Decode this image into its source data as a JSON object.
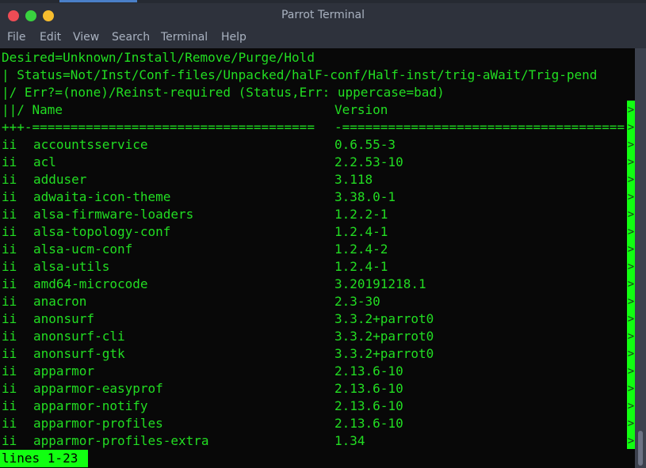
{
  "window": {
    "title": "Parrot Terminal",
    "controls": [
      "close",
      "maximize",
      "minimize"
    ]
  },
  "menu": [
    "File",
    "Edit",
    "View",
    "Search",
    "Terminal",
    "Help"
  ],
  "header_lines": [
    "Desired=Unknown/Install/Remove/Purge/Hold",
    "| Status=Not/Inst/Conf-files/Unpacked/halF-conf/Half-inst/trig-aWait/Trig-pend",
    "|/ Err?=(none)/Reinst-required (Status,Err: uppercase=bad)"
  ],
  "columns": {
    "name_header": "||/ Name",
    "version_header": "Version",
    "separator_name": "+++-=====================================",
    "separator_version": "-====================================="
  },
  "packages": [
    {
      "status": "ii",
      "name": "accountsservice",
      "version": "0.6.55-3"
    },
    {
      "status": "ii",
      "name": "acl",
      "version": "2.2.53-10"
    },
    {
      "status": "ii",
      "name": "adduser",
      "version": "3.118"
    },
    {
      "status": "ii",
      "name": "adwaita-icon-theme",
      "version": "3.38.0-1"
    },
    {
      "status": "ii",
      "name": "alsa-firmware-loaders",
      "version": "1.2.2-1"
    },
    {
      "status": "ii",
      "name": "alsa-topology-conf",
      "version": "1.2.4-1"
    },
    {
      "status": "ii",
      "name": "alsa-ucm-conf",
      "version": "1.2.4-2"
    },
    {
      "status": "ii",
      "name": "alsa-utils",
      "version": "1.2.4-1"
    },
    {
      "status": "ii",
      "name": "amd64-microcode",
      "version": "3.20191218.1"
    },
    {
      "status": "ii",
      "name": "anacron",
      "version": "2.3-30"
    },
    {
      "status": "ii",
      "name": "anonsurf",
      "version": "3.3.2+parrot0"
    },
    {
      "status": "ii",
      "name": "anonsurf-cli",
      "version": "3.3.2+parrot0"
    },
    {
      "status": "ii",
      "name": "anonsurf-gtk",
      "version": "3.3.2+parrot0"
    },
    {
      "status": "ii",
      "name": "apparmor",
      "version": "2.13.6-10"
    },
    {
      "status": "ii",
      "name": "apparmor-easyprof",
      "version": "2.13.6-10"
    },
    {
      "status": "ii",
      "name": "apparmor-notify",
      "version": "2.13.6-10"
    },
    {
      "status": "ii",
      "name": "apparmor-profiles",
      "version": "2.13.6-10"
    },
    {
      "status": "ii",
      "name": "apparmor-profiles-extra",
      "version": "1.34"
    }
  ],
  "overflow_marker": ">",
  "pager_status": "lines 1-23",
  "colors": {
    "terminal_fg": "#22dd22",
    "terminal_bg": "#080808",
    "highlight": "#11ff11",
    "chrome": "#2e323c"
  }
}
